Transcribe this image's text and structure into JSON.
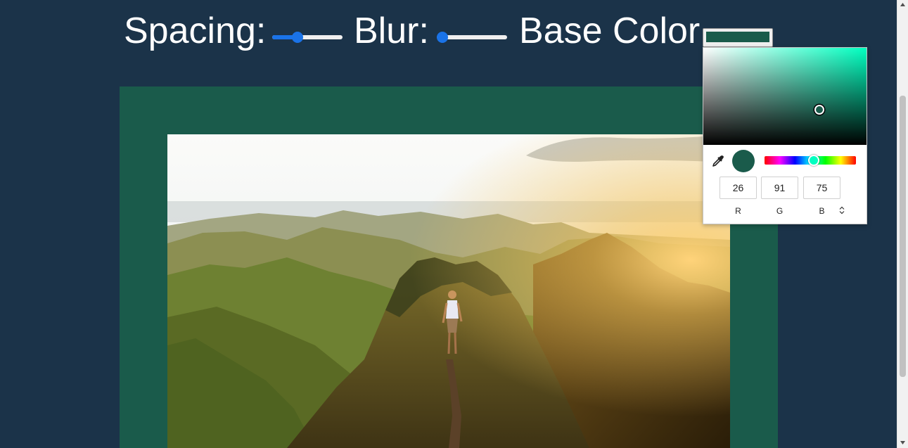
{
  "controls": {
    "spacing_label": "Spacing:",
    "spacing_value": 0.33,
    "blur_label": "Blur:",
    "blur_value": 0.0,
    "base_color_label": "Base Color",
    "base_color_value": "#1a5b4b"
  },
  "picker": {
    "hue_color": "#00ffc0",
    "saturation": 0.71,
    "brightness": 0.36,
    "hue_position": 0.54,
    "r_value": "26",
    "g_value": "91",
    "b_value": "75",
    "r_label": "R",
    "g_label": "G",
    "b_label": "B",
    "eyedropper_icon": "eyedropper-icon",
    "mode_toggle_icon": "up-down-arrows-icon"
  },
  "colors": {
    "page_background": "#1b3349",
    "accent": "#1a73e8",
    "frame_color": "#1a5b4b"
  },
  "image": {
    "subject": "hiker-on-mountain-ridge"
  }
}
